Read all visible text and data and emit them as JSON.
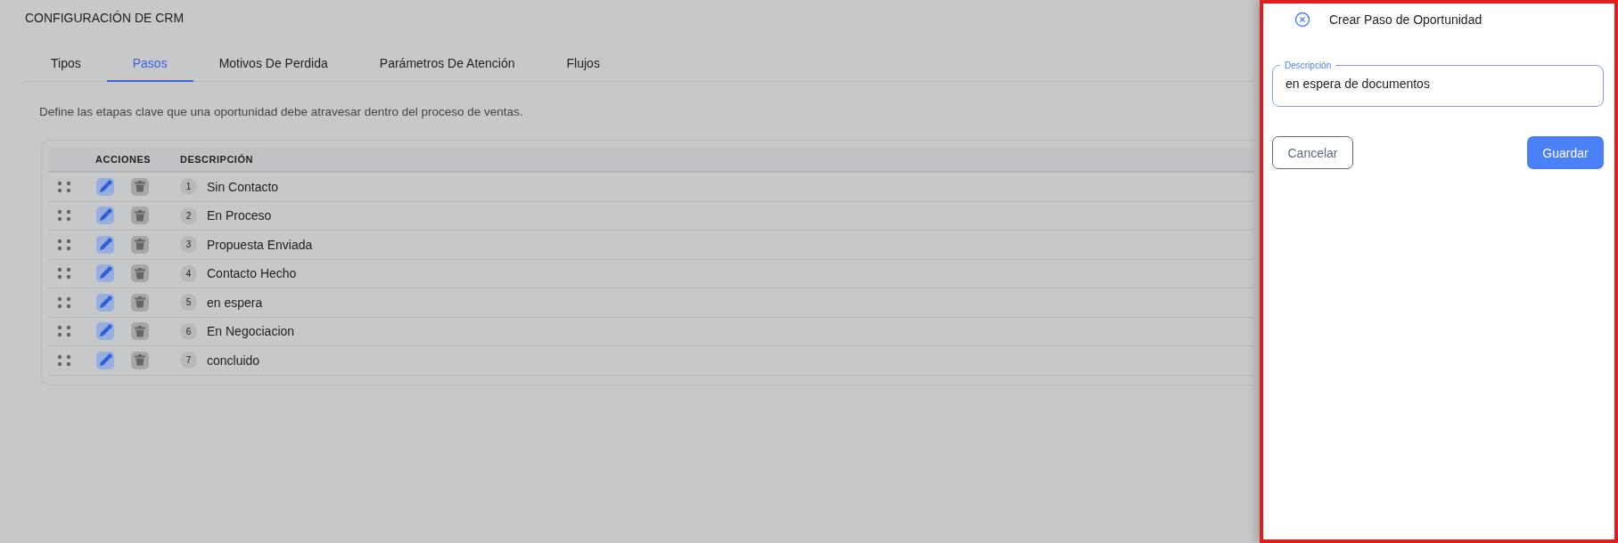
{
  "page": {
    "title": "CONFIGURACIÓN DE CRM"
  },
  "tabs": [
    {
      "label": "Tipos",
      "selected": false
    },
    {
      "label": "Pasos",
      "selected": true
    },
    {
      "label": "Motivos De Perdida",
      "selected": false
    },
    {
      "label": "Parámetros De Atención",
      "selected": false
    },
    {
      "label": "Flujos",
      "selected": false
    }
  ],
  "intro": "Define las etapas clave que una oportunidad debe atravesar dentro del proceso de ventas.",
  "table": {
    "columns": [
      "ACCIONES",
      "DESCRIPCIÓN"
    ],
    "rows": [
      {
        "number": "1",
        "description": "Sin Contacto"
      },
      {
        "number": "2",
        "description": "En Proceso"
      },
      {
        "number": "3",
        "description": "Propuesta Enviada"
      },
      {
        "number": "4",
        "description": "Contacto Hecho"
      },
      {
        "number": "5",
        "description": "en espera"
      },
      {
        "number": "6",
        "description": "En Negociacion"
      },
      {
        "number": "7",
        "description": "concluido"
      }
    ]
  },
  "panel": {
    "title": "Crear Paso de Oportunidad",
    "field": {
      "label": "Descripción",
      "value": "en espera de documentos"
    },
    "buttons": [
      {
        "label": "Cancelar",
        "kind": "secondary"
      },
      {
        "label": "Guardar",
        "kind": "primary"
      }
    ]
  }
}
